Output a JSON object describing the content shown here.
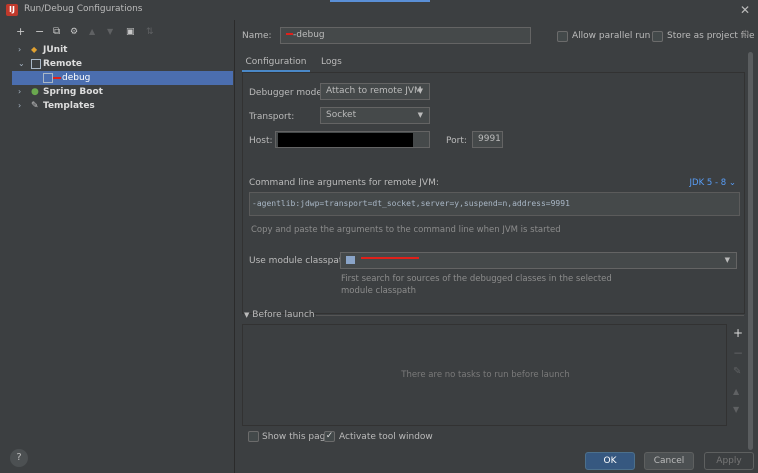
{
  "window": {
    "title": "Run/Debug Configurations"
  },
  "toolbar": {
    "add": "+",
    "remove": "−",
    "copy": "⧉",
    "edit": "🔧",
    "up": "▲",
    "down": "▼",
    "folder": "📁",
    "sort": "⇅"
  },
  "tree": [
    {
      "label": "JUnit",
      "expanded": false
    },
    {
      "label": "Remote",
      "expanded": true
    },
    {
      "label": "debug",
      "selected": true
    },
    {
      "label": "Spring Boot",
      "expanded": false
    },
    {
      "label": "Templates",
      "expanded": false
    }
  ],
  "form": {
    "name_label": "Name:",
    "name_value": "-debug",
    "allow_parallel_label": "Allow parallel run",
    "store_as_project_label": "Store as project file"
  },
  "tabs": [
    {
      "label": "Configuration",
      "active": true
    },
    {
      "label": "Logs",
      "active": false
    }
  ],
  "config": {
    "debugger_mode_label": "Debugger mode:",
    "debugger_mode_value": "Attach to remote JVM",
    "transport_label": "Transport:",
    "transport_value": "Socket",
    "host_label": "Host:",
    "port_label": "Port:",
    "port_value": "9991",
    "cmd_label": "Command line arguments for remote JVM:",
    "jdk_link": "JDK 5 - 8",
    "cmd_value": "-agentlib:jdwp=transport=dt_socket,server=y,suspend=n,address=9991",
    "cmd_hint": "Copy and paste the arguments to the command line when JVM is started",
    "module_classpath_label": "Use module classpath:",
    "module_hint_line1": "First search for sources of the debugged classes in the selected",
    "module_hint_line2": "module classpath"
  },
  "before_launch": {
    "header": "Before launch",
    "empty_text": "There are no tasks to run before launch",
    "add": "+",
    "remove": "−",
    "edit": "✎",
    "up": "▲",
    "down": "▼"
  },
  "footer": {
    "show_page_label": "Show this page",
    "activate_label": "Activate tool window",
    "ok": "OK",
    "cancel": "Cancel",
    "apply": "Apply",
    "help": "?"
  },
  "colors": {
    "selection": "#4b6eaf",
    "primary": "#365880",
    "link": "#589df6"
  }
}
